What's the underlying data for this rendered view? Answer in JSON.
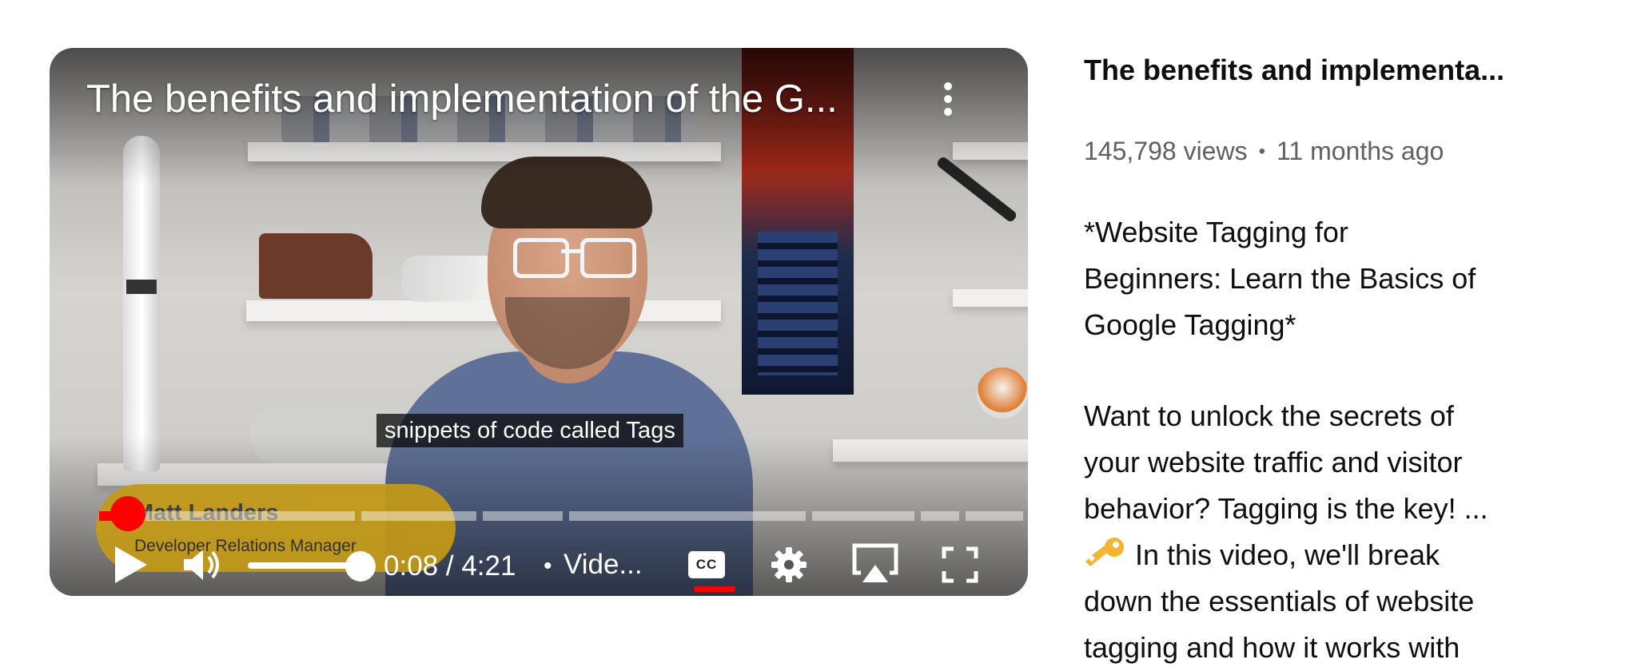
{
  "player": {
    "title": "The benefits and implementation of the G...",
    "caption": "snippets of code called Tags",
    "lower_third": {
      "name": "Matt Landers",
      "role": "Developer Relations Manager"
    },
    "time": {
      "current": "0:08",
      "separator": " / ",
      "total": "4:21"
    },
    "chapter_label": "Vide...",
    "cc_label": "CC",
    "progress_fraction": 0.03,
    "volume_fraction": 0.9,
    "icons": [
      "more-vert-icon",
      "play-icon",
      "volume-icon",
      "cc-icon",
      "settings-icon",
      "airplay-icon",
      "fullscreen-icon"
    ]
  },
  "info": {
    "title": "The benefits and implementa...",
    "views": "145,798 views",
    "age": "11 months ago",
    "description": {
      "line1": "*Website Tagging for",
      "line2": "Beginners: Learn the Basics of",
      "line3": "Google Tagging*",
      "line4": "Want to unlock the secrets of",
      "line5": "your website traffic and visitor",
      "line6": "behavior? Tagging is the key! ...",
      "line7": "In this video, we'll break",
      "line8": "down the essentials of website",
      "line9": "tagging and how it works with"
    }
  },
  "colors": {
    "accent": "#ff0000",
    "meta_text": "#606060",
    "lower_third": "#c49a16"
  }
}
